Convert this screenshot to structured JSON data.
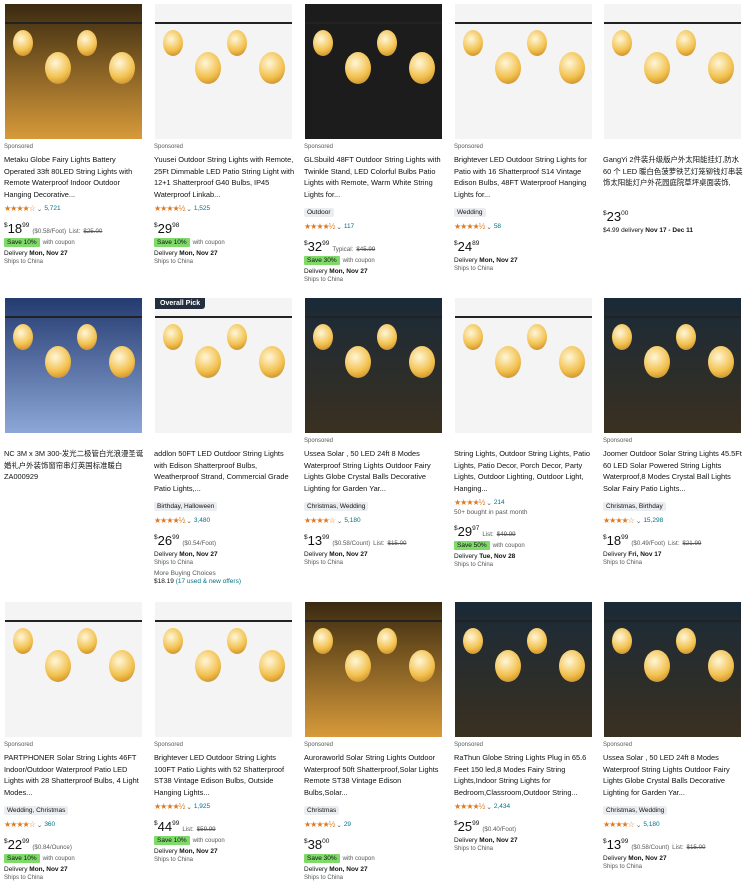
{
  "products": [
    {
      "sponsored": "Sponsored",
      "title": "Metaku Globe Fairy Lights Battery Operated 33ft 80LED String Lights with Remote Waterproof Indoor Outdoor Hanging Decorative...",
      "stars": "★★★★☆",
      "rating_count": "5,721",
      "price_whole": "18",
      "price_fraction": "99",
      "unit_price": "($0.58/Foot)",
      "list_label": "List:",
      "list_price": "$25.00",
      "save": "Save 10%",
      "coupon": "with coupon",
      "delivery_label": "Delivery",
      "delivery_date": "Mon, Nov 27",
      "ships": "Ships to China"
    },
    {
      "sponsored": "Sponsored",
      "title": "Yuusei Outdoor String Lights with Remote, 25Ft Dimmable LED Patio String Light with 12+1 Shatterproof G40 Bulbs, IP45 Waterproof Linkab...",
      "stars": "★★★★½",
      "rating_count": "1,525",
      "price_whole": "29",
      "price_fraction": "98",
      "save": "Save 10%",
      "coupon": "with coupon",
      "delivery_label": "Delivery",
      "delivery_date": "Mon, Nov 27",
      "ships": "Ships to China"
    },
    {
      "sponsored": "Sponsored",
      "title": "GLSbuild 48FT Outdoor String Lights with Twinkle Stand, LED Colorful Bulbs Patio Lights with Remote, Warm White String Lights for...",
      "tag": "Outdoor",
      "stars": "★★★★½",
      "rating_count": "117",
      "price_whole": "32",
      "price_fraction": "99",
      "unit_price": "Typical:",
      "list_price": "$45.99",
      "save": "Save 30%",
      "coupon": "with coupon",
      "delivery_label": "Delivery",
      "delivery_date": "Mon, Nov 27",
      "ships": "Ships to China"
    },
    {
      "sponsored": "Sponsored",
      "title": "Brightever LED Outdoor String Lights for Patio with 16 Shatterproof S14 Vintage Edison Bulbs, 48FT Waterproof Hanging Lights for...",
      "tag": "Wedding",
      "stars": "★★★★½",
      "rating_count": "58",
      "price_whole": "24",
      "price_fraction": "89",
      "delivery_label": "Delivery",
      "delivery_date": "Mon, Nov 27",
      "ships": "Ships to China"
    },
    {
      "title": "GangYi 2件装升级版户外太阳能挂灯,防水 60 个 LED 暖白色菠萝铁艺灯笼铆钱灯串装饰太阳能灯户外花园庭院草坪桌面装饰,",
      "price_whole": "23",
      "price_fraction": "00",
      "delivery_label": "$4.99 delivery",
      "delivery_date": "Nov 17 - Dec 11"
    },
    {
      "title": "NC 3M x 3M 300-发光二极管白光浪漫圣诞婚礼户外装饰窗帘串灯英国标准暖白ZA000929"
    },
    {
      "badge": "Overall Pick",
      "title": "addlon 50FT LED Outdoor String Lights with Edison Shatterproof Bulbs, Weatherproof Strand, Commercial Grade Patio Lights,...",
      "tag": "Birthday, Halloween",
      "stars": "★★★★½",
      "rating_count": "3,480",
      "price_whole": "26",
      "price_fraction": "99",
      "unit_price": "($0.54/Foot)",
      "delivery_label": "Delivery",
      "delivery_date": "Mon, Nov 27",
      "ships": "Ships to China",
      "more_label": "More Buying Choices",
      "more_price": "$18.19",
      "more_offers": "(17 used & new offers)"
    },
    {
      "sponsored": "Sponsored",
      "title": "Ussea Solar , 50 LED 24ft 8 Modes Waterproof String Lights Outdoor Fairy Lights Globe Crystal Balls Decorative Lighting for Garden Yar...",
      "tag": "Christmas, Wedding",
      "stars": "★★★★☆",
      "rating_count": "5,180",
      "price_whole": "13",
      "price_fraction": "99",
      "unit_price": "($0.58/Count)",
      "list_label": "List:",
      "list_price": "$15.00",
      "delivery_label": "Delivery",
      "delivery_date": "Mon, Nov 27",
      "ships": "Ships to China"
    },
    {
      "title": "String Lights, Outdoor String Lights, Patio Lights, Patio Decor, Porch Decor, Party Lights, Outdoor Lighting, Outdoor Light, Hanging...",
      "stars": "★★★★½",
      "rating_count": "214",
      "bought": "50+ bought in past month",
      "price_whole": "29",
      "price_fraction": "97",
      "list_label": "List:",
      "list_price": "$49.99",
      "save": "Save 50%",
      "coupon": "with coupon",
      "delivery_label": "Delivery",
      "delivery_date": "Tue, Nov 28",
      "ships": "Ships to China"
    },
    {
      "sponsored": "Sponsored",
      "title": "Joomer Outdoor Solar String Lights 45.5Ft 60 LED Solar Powered String Lights Waterproof,8 Modes Crystal Ball Lights Solar Fairy Patio Lights...",
      "tag": "Christmas, Birthday",
      "stars": "★★★★☆",
      "rating_count": "15,298",
      "price_whole": "18",
      "price_fraction": "99",
      "unit_price": "($0.49/Foot)",
      "list_label": "List:",
      "list_price": "$21.99",
      "delivery_label": "Delivery",
      "delivery_date": "Fri, Nov 17",
      "ships": "Ships to China"
    },
    {
      "sponsored": "Sponsored",
      "title": "PARTPHONER Solar String Lights 46FT Indoor/Outdoor Waterproof Patio LED Lights with 28 Shatterproof Bulbs, 4 Light Modes...",
      "tag": "Wedding, Christmas",
      "stars": "★★★★☆",
      "rating_count": "360",
      "price_whole": "22",
      "price_fraction": "99",
      "unit_price": "($0.84/Ounce)",
      "save": "Save 10%",
      "coupon": "with coupon",
      "delivery_label": "Delivery",
      "delivery_date": "Mon, Nov 27",
      "ships": "Ships to China"
    },
    {
      "sponsored": "Sponsored",
      "title": "Brightever LED Outdoor String Lights 100FT Patio Lights with 52 Shatterproof ST38 Vintage Edison Bulbs, Outside Hanging Lights...",
      "stars": "★★★★½",
      "rating_count": "1,925",
      "price_whole": "44",
      "price_fraction": "99",
      "list_label": "List:",
      "list_price": "$59.99",
      "save": "Save 10%",
      "coupon": "with coupon",
      "delivery_label": "Delivery",
      "delivery_date": "Mon, Nov 27",
      "ships": "Ships to China"
    },
    {
      "sponsored": "Sponsored",
      "title": "Auroraworld Solar String Lights Outdoor Waterproof 50ft Shatterproof,Solar Lights Remote ST38 Vintage Edison Bulbs,Solar...",
      "tag": "Christmas",
      "stars": "★★★★½",
      "rating_count": "29",
      "price_whole": "38",
      "price_fraction": "00",
      "save": "Save 30%",
      "coupon": "with coupon",
      "delivery_label": "Delivery",
      "delivery_date": "Mon, Nov 27",
      "ships": "Ships to China"
    },
    {
      "sponsored": "Sponsored",
      "title": "RaThun Globe String Lights Plug in 65.6 Feet 150 led,8 Modes Fairy String Lights,Indoor String Lights for Bedroom,Classroom,Outdoor String...",
      "stars": "★★★★½",
      "rating_count": "2,434",
      "price_whole": "25",
      "price_fraction": "99",
      "unit_price": "($0.40/Foot)",
      "delivery_label": "Delivery",
      "delivery_date": "Mon, Nov 27",
      "ships": "Ships to China"
    },
    {
      "sponsored": "Sponsored",
      "title": "Ussea Solar , 50 LED 24ft 8 Modes Waterproof String Lights Outdoor Fairy Lights Globe Crystal Balls Decorative Lighting for Garden Yar...",
      "tag": "Christmas, Wedding",
      "stars": "★★★★☆",
      "rating_count": "5,180",
      "price_whole": "13",
      "price_fraction": "99",
      "unit_price": "($0.58/Count)",
      "list_label": "List:",
      "list_price": "$15.00",
      "delivery_label": "Delivery",
      "delivery_date": "Mon, Nov 27",
      "ships": "Ships to China"
    }
  ]
}
